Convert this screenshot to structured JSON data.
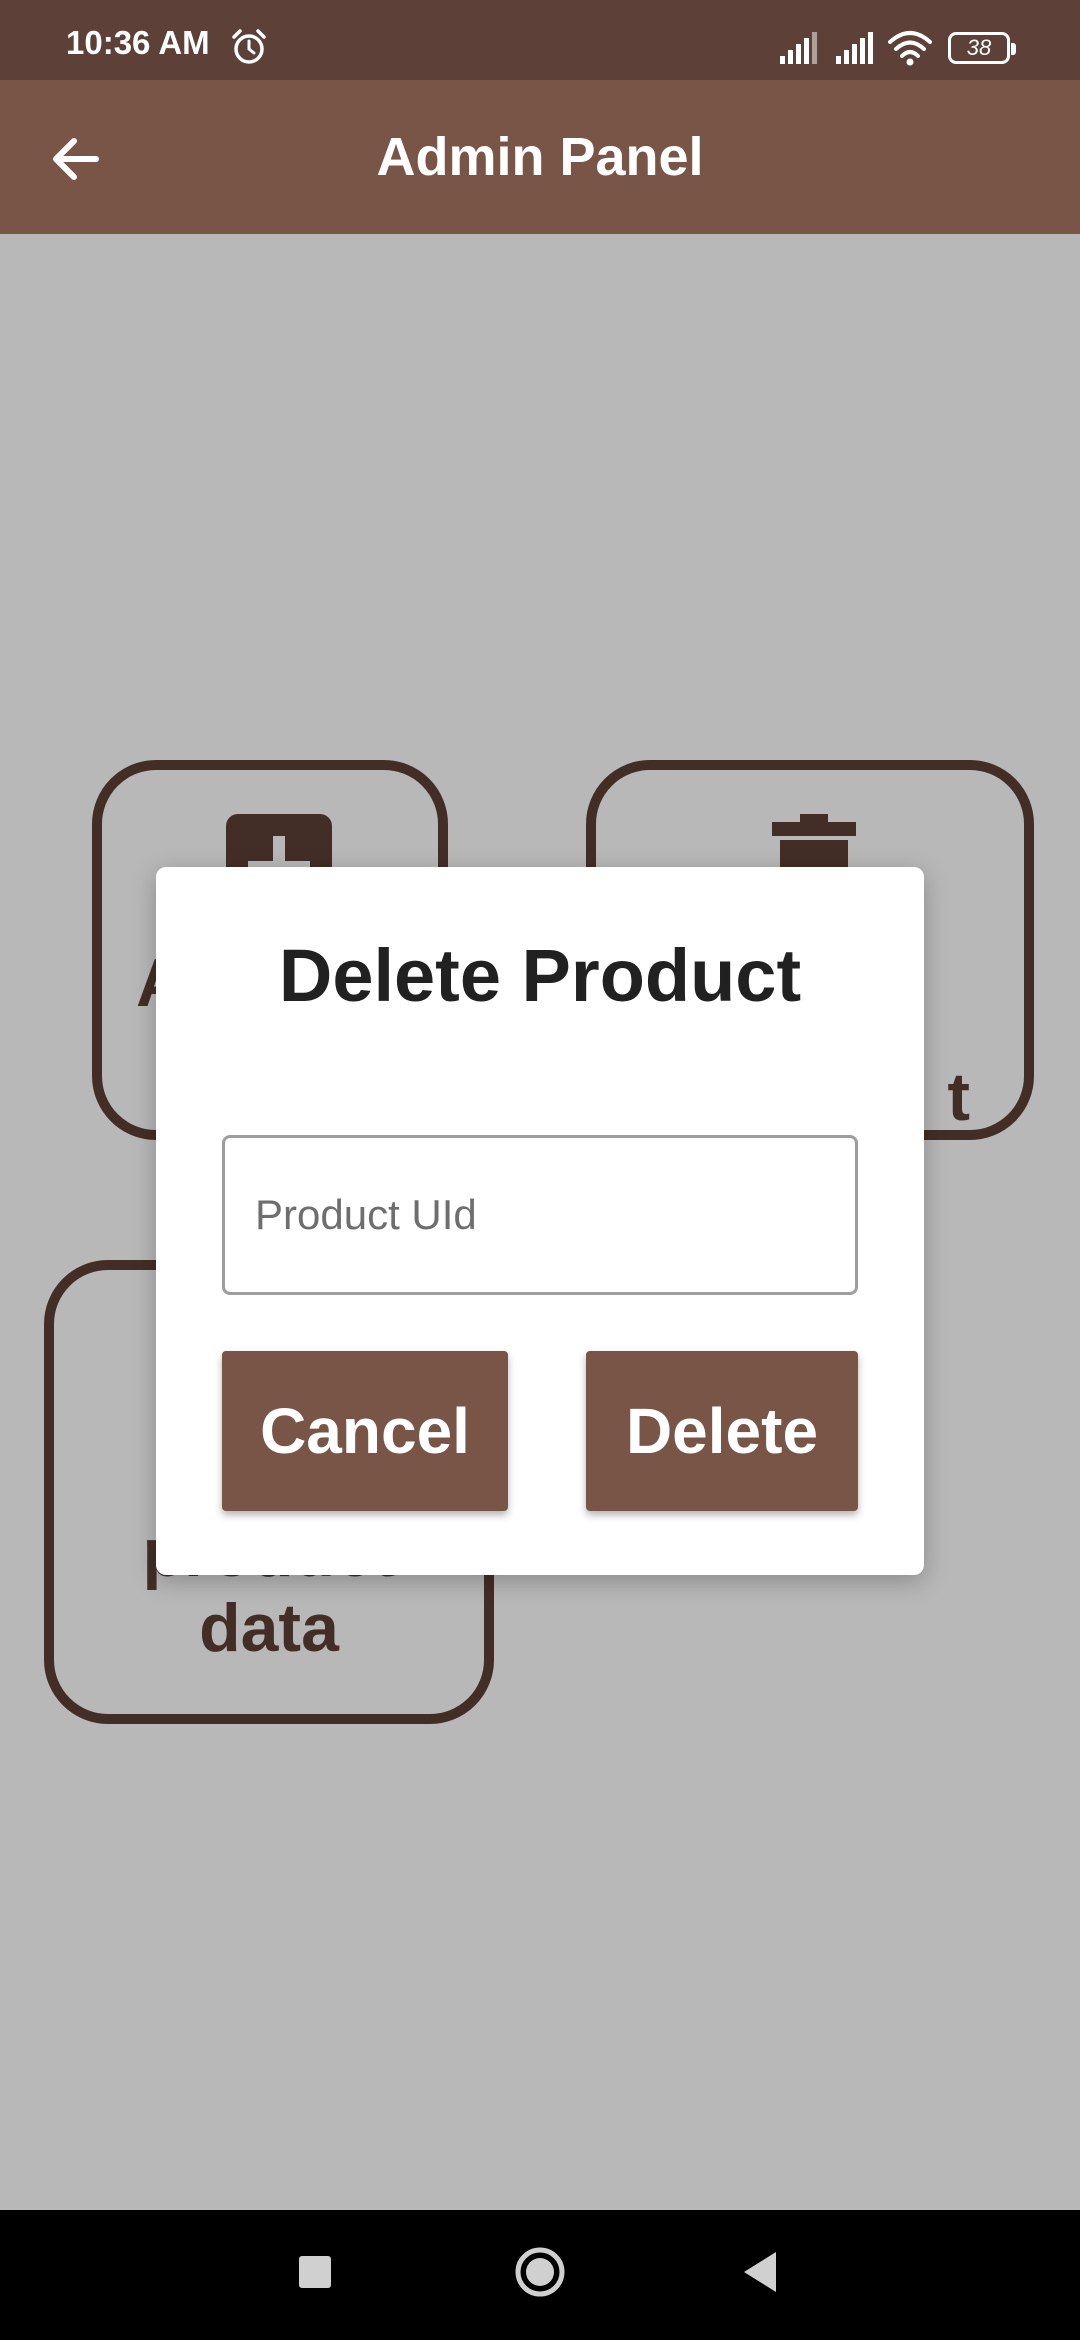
{
  "status_bar": {
    "time": "10:36 AM",
    "battery": "38",
    "icons": [
      "alarm-icon",
      "signal-icon",
      "signal-icon",
      "wifi-icon",
      "battery-icon"
    ]
  },
  "app_bar": {
    "title": "Admin Panel",
    "back_icon": "arrow-left-icon"
  },
  "cards": {
    "add": {
      "label": "A",
      "icon": "add-box-icon"
    },
    "delete": {
      "label": "t",
      "icon": "trash-icon"
    },
    "view": {
      "label_line1": "product",
      "label_line2": "data"
    }
  },
  "dialog": {
    "title": "Delete Product",
    "input_placeholder": "Product UId",
    "input_value": "",
    "cancel_label": "Cancel",
    "delete_label": "Delete"
  },
  "nav_bar": {
    "icons": [
      "recents-icon",
      "home-icon",
      "back-triangle-icon"
    ]
  },
  "colors": {
    "status_bar": "#5d4037",
    "app_bar": "#795548",
    "primary_dark": "#5d4037",
    "button": "#795548"
  }
}
